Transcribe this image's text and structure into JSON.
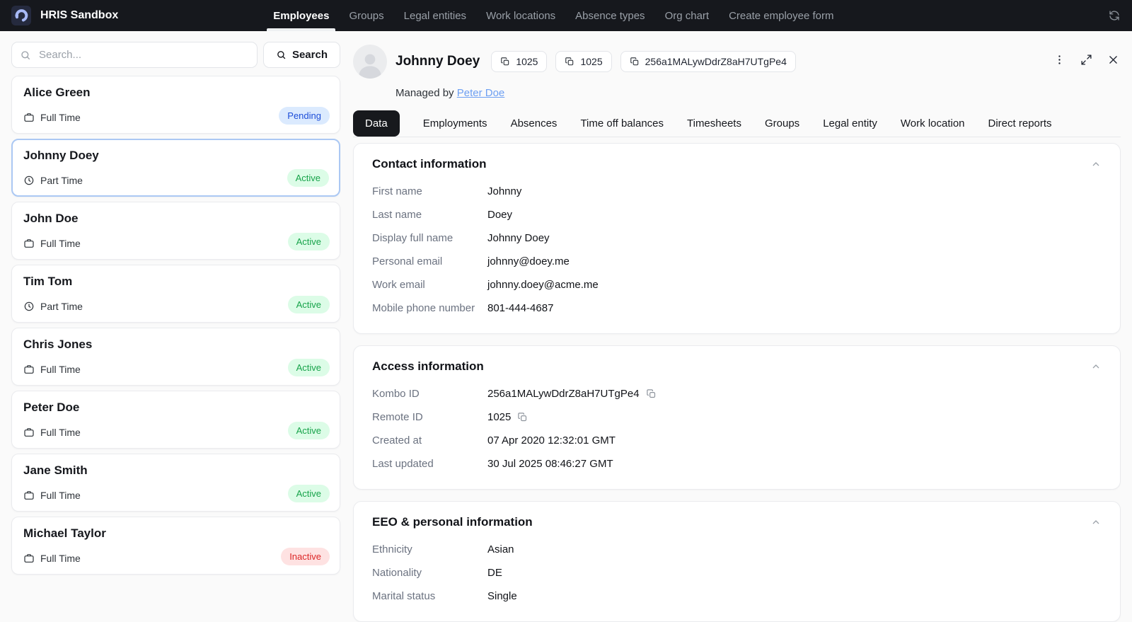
{
  "nav": {
    "brand": "HRIS Sandbox",
    "items": [
      {
        "label": "Employees",
        "active": true
      },
      {
        "label": "Groups"
      },
      {
        "label": "Legal entities"
      },
      {
        "label": "Work locations"
      },
      {
        "label": "Absence types"
      },
      {
        "label": "Org chart"
      },
      {
        "label": "Create employee form"
      }
    ],
    "refresh_icon": "refresh-icon"
  },
  "sidebar": {
    "search": {
      "placeholder": "Search...",
      "button_label": "Search",
      "icon": "search-icon"
    },
    "employees": [
      {
        "name": "Alice Green",
        "employment_type": "Full Time",
        "icon": "briefcase",
        "status": "Pending",
        "selected": false
      },
      {
        "name": "Johnny Doey",
        "employment_type": "Part Time",
        "icon": "clock",
        "status": "Active",
        "selected": true
      },
      {
        "name": "John Doe",
        "employment_type": "Full Time",
        "icon": "briefcase",
        "status": "Active",
        "selected": false
      },
      {
        "name": "Tim Tom",
        "employment_type": "Part Time",
        "icon": "clock",
        "status": "Active",
        "selected": false
      },
      {
        "name": "Chris Jones",
        "employment_type": "Full Time",
        "icon": "briefcase",
        "status": "Active",
        "selected": false
      },
      {
        "name": "Peter Doe",
        "employment_type": "Full Time",
        "icon": "briefcase",
        "status": "Active",
        "selected": false
      },
      {
        "name": "Jane Smith",
        "employment_type": "Full Time",
        "icon": "briefcase",
        "status": "Active",
        "selected": false
      },
      {
        "name": "Michael Taylor",
        "employment_type": "Full Time",
        "icon": "briefcase",
        "status": "Inactive",
        "selected": false
      }
    ]
  },
  "detail": {
    "name": "Johnny Doey",
    "avatar_icon": "person-icon",
    "chips": [
      {
        "icon": "copy-icon",
        "label": "1025"
      },
      {
        "icon": "copy-icon",
        "label": "1025"
      },
      {
        "icon": "copy-icon",
        "label": "256a1MALywDdrZ8aH7UTgPe4"
      }
    ],
    "managed_by_prefix": "Managed by",
    "manager_link": "Peter Doe",
    "actions": [
      "kebab-menu-icon",
      "expand-icon",
      "close-icon"
    ],
    "tabs": [
      {
        "label": "Data",
        "active": true
      },
      {
        "label": "Employments"
      },
      {
        "label": "Absences"
      },
      {
        "label": "Time off balances"
      },
      {
        "label": "Timesheets"
      },
      {
        "label": "Groups"
      },
      {
        "label": "Legal entity"
      },
      {
        "label": "Work location"
      },
      {
        "label": "Direct reports"
      }
    ],
    "sections": [
      {
        "title": "Contact information",
        "collapse_icon": "chevron-up-icon",
        "rows": [
          {
            "label": "First name",
            "value": "Johnny"
          },
          {
            "label": "Last name",
            "value": "Doey"
          },
          {
            "label": "Display full name",
            "value": "Johnny Doey"
          },
          {
            "label": "Personal email",
            "value": "johnny@doey.me"
          },
          {
            "label": "Work email",
            "value": "johnny.doey@acme.me"
          },
          {
            "label": "Mobile phone number",
            "value": "801-444-4687"
          }
        ]
      },
      {
        "title": "Access information",
        "collapse_icon": "chevron-up-icon",
        "rows": [
          {
            "label": "Kombo ID",
            "value": "256a1MALywDdrZ8aH7UTgPe4",
            "copyable": true
          },
          {
            "label": "Remote ID",
            "value": "1025",
            "copyable": true
          },
          {
            "label": "Created at",
            "value": "07 Apr 2020 12:32:01 GMT"
          },
          {
            "label": "Last updated",
            "value": "30 Jul 2025 08:46:27 GMT"
          }
        ]
      },
      {
        "title": "EEO & personal information",
        "collapse_icon": "chevron-up-icon",
        "rows": [
          {
            "label": "Ethnicity",
            "value": "Asian"
          },
          {
            "label": "Nationality",
            "value": "DE"
          },
          {
            "label": "Marital status",
            "value": "Single"
          }
        ]
      }
    ]
  },
  "colors": {
    "nav_bg": "#16181d",
    "page_bg": "#fafafa",
    "accent_link": "#6d9ff2",
    "selected_card_border": "#abc8f3",
    "tab_active_bg": "#17191d",
    "badge_pending_bg": "#dbeafe",
    "badge_pending_text": "#1d4ed8",
    "badge_active_bg": "#dcfce7",
    "badge_active_text": "#17a34a",
    "badge_inactive_bg": "#fee2e2",
    "badge_inactive_text": "#dc2626",
    "logo_color": "#a7b9f6"
  }
}
